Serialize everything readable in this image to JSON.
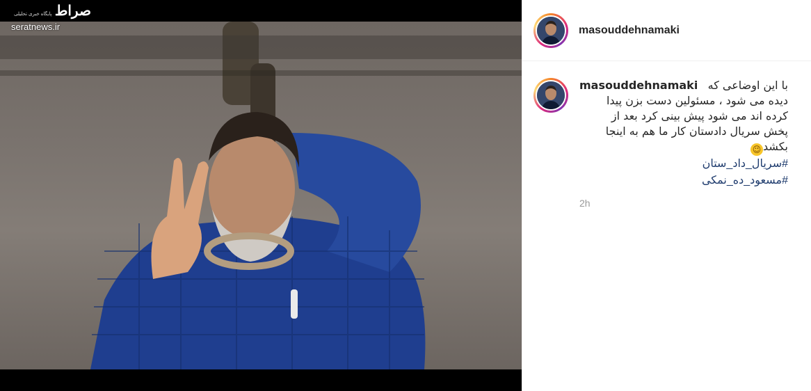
{
  "watermark": {
    "logo_text": "صراط",
    "subtitle": "پایگاه خبری تحلیلی",
    "url": "seratnews.ir"
  },
  "post": {
    "username": "masouddehnamaki",
    "caption_lines": [
      "با این اوضاعی که",
      "دیده می شود ، مسئولین دست بزن پیدا",
      "کرده اند می شود پیش بینی کرد بعد از",
      "پخش سریال دادستان کار ما هم به اینجا",
      "بکشد"
    ],
    "emoji": "wink-emoji",
    "hashtags": [
      "#سریال_داد_ستان",
      "#مسعود_ده_نمکی"
    ],
    "timestamp": "2h"
  },
  "icons": {
    "avatar": "avatar-icon"
  }
}
